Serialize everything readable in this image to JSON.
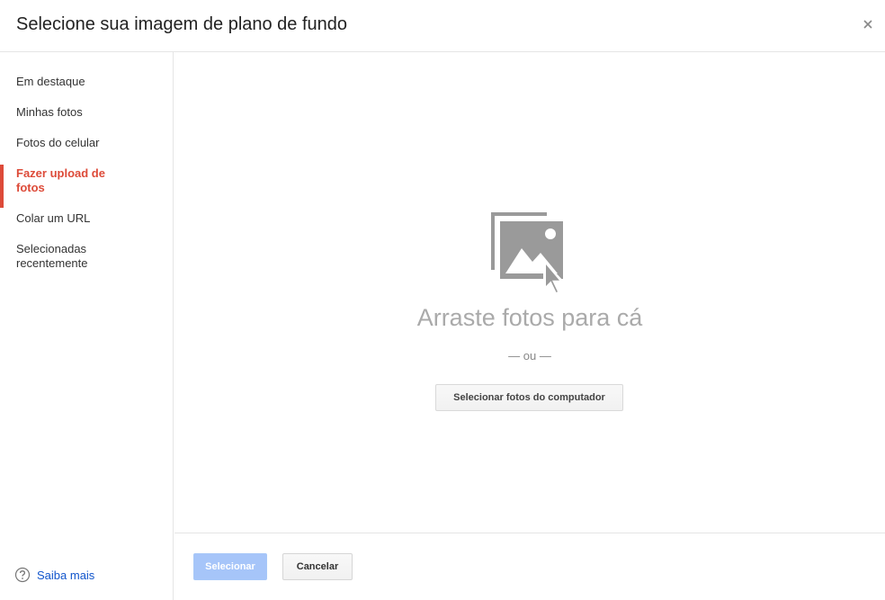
{
  "dialog": {
    "title": "Selecione sua imagem de plano de fundo",
    "close_icon": "close-icon"
  },
  "sidebar": {
    "items": [
      {
        "label": "Em destaque",
        "active": false
      },
      {
        "label": "Minhas fotos",
        "active": false
      },
      {
        "label": "Fotos do celular",
        "active": false
      },
      {
        "label": "Fazer upload de fotos",
        "active": true
      },
      {
        "label": "Colar um URL",
        "active": false
      },
      {
        "label": "Selecionadas recentemente",
        "active": false
      }
    ],
    "help": {
      "label": "Saiba mais",
      "icon": "help-circle-icon"
    }
  },
  "main": {
    "upload_icon": "photo-upload-icon",
    "drop_text": "Arraste fotos para cá",
    "or_text": "— ou —",
    "pick_button": "Selecionar fotos do computador"
  },
  "footer": {
    "select_label": "Selecionar",
    "cancel_label": "Cancelar"
  },
  "colors": {
    "accent": "#dd4b39",
    "link": "#1155cc",
    "primary_disabled": "#a6c5f9",
    "muted_text": "#aaaaaa"
  }
}
